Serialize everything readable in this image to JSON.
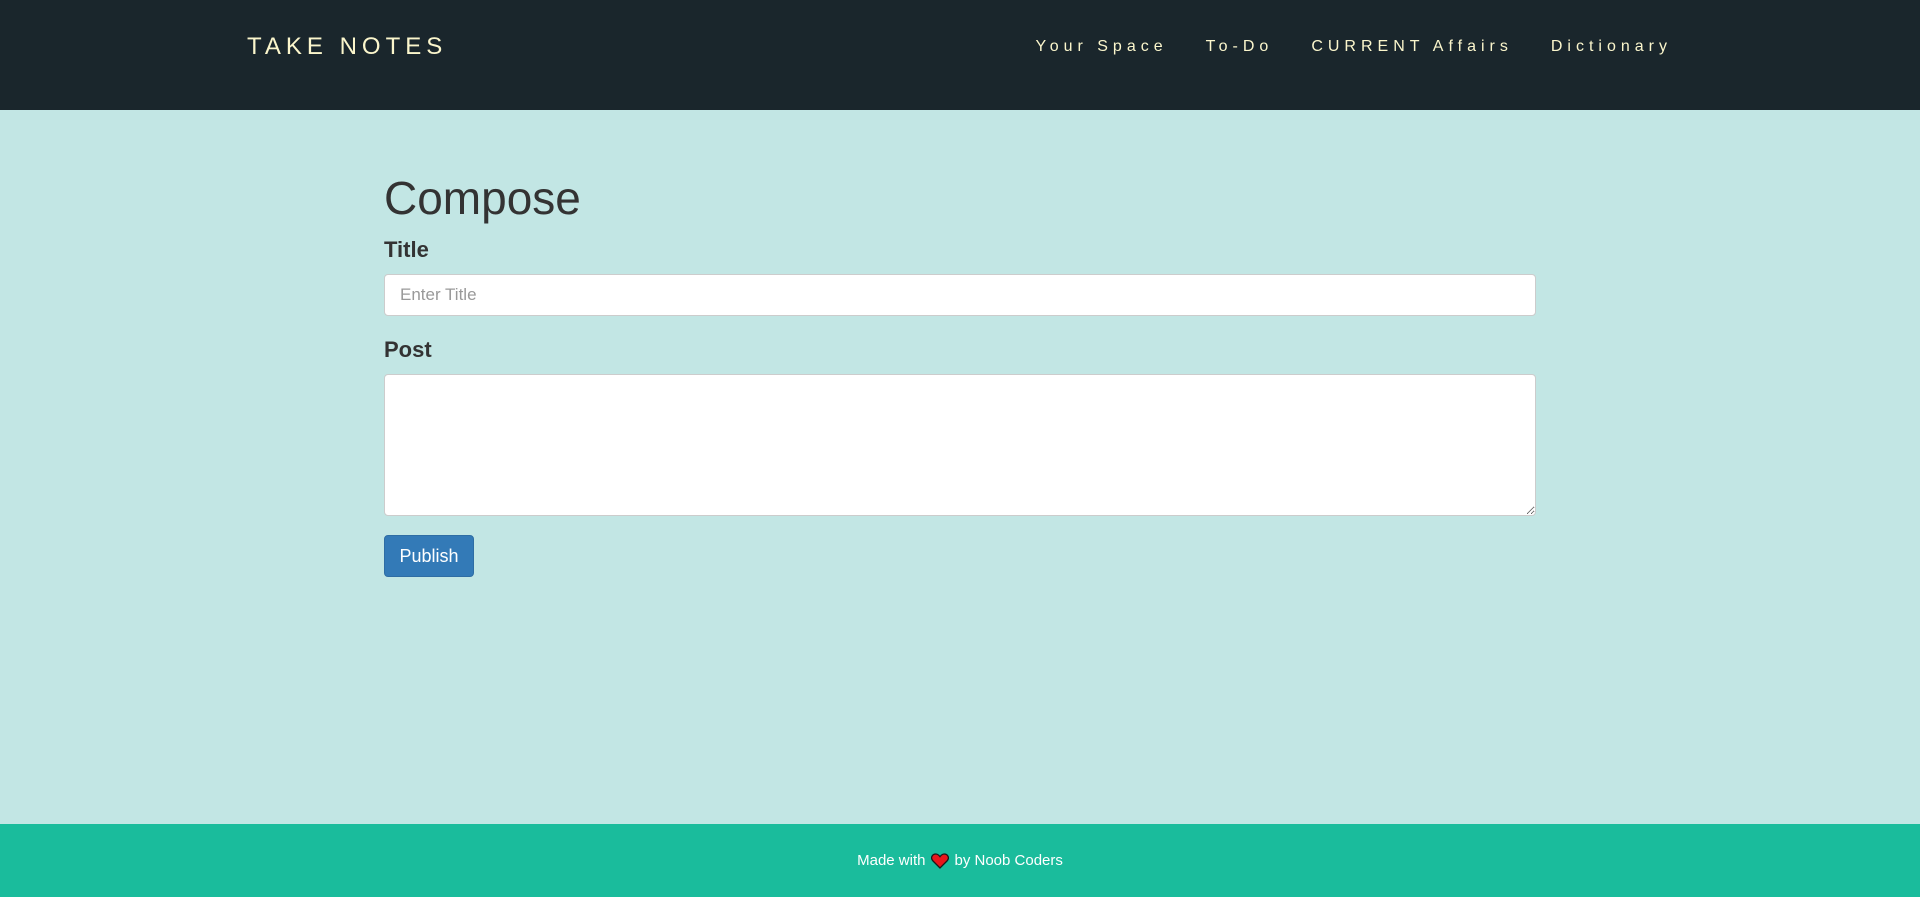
{
  "navbar": {
    "brand": "TAKE NOTES",
    "links": [
      {
        "label": "Your Space"
      },
      {
        "label": "To-Do"
      },
      {
        "label": "CURRENT Affairs"
      },
      {
        "label": "Dictionary"
      }
    ]
  },
  "compose": {
    "heading": "Compose",
    "title_label": "Title",
    "title_placeholder": "Enter Title",
    "title_value": "",
    "post_label": "Post",
    "post_value": "",
    "publish_label": "Publish"
  },
  "footer": {
    "prefix": "Made with",
    "icon": "heart-icon",
    "suffix": "by Noob Coders"
  },
  "colors": {
    "navbar_bg": "#1a262c",
    "nav_text": "#fbf6cc",
    "page_bg": "#c2e6e4",
    "footer_bg": "#1abc9c",
    "button_bg": "#337ab7",
    "heart": "#e8171b"
  }
}
